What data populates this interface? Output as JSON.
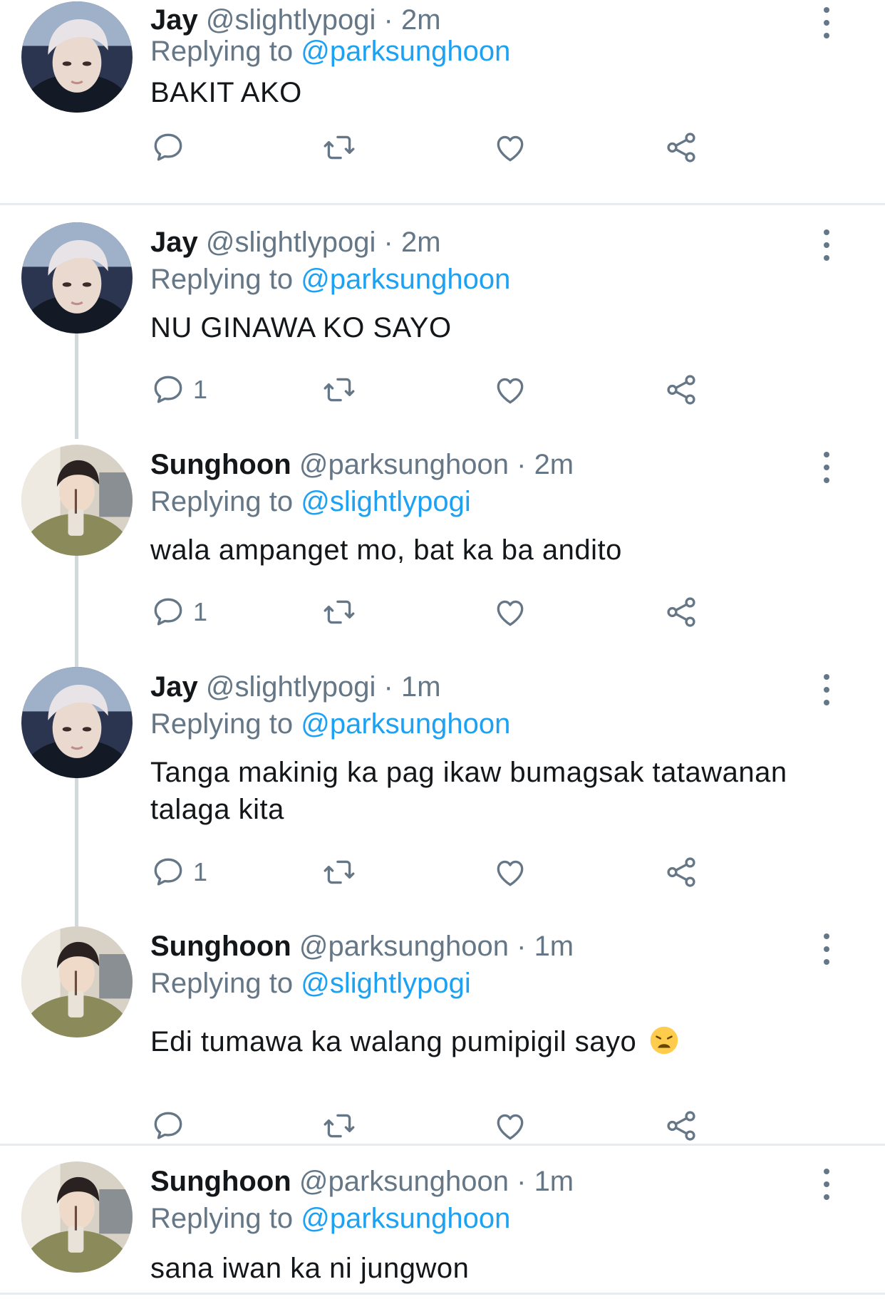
{
  "colors": {
    "accent": "#1da1f2",
    "secondary_text": "#657786",
    "primary_text": "#14171a",
    "thread_line": "#cfd9de",
    "divider": "#e6ecf0"
  },
  "icons": [
    "reply-icon",
    "retweet-icon",
    "like-icon",
    "share-icon",
    "more-options-icon"
  ],
  "tweets": [
    {
      "name": "Jay",
      "handle": "@slightlypogi",
      "sep": "·",
      "time": "2m",
      "replying_prefix": "Replying to",
      "replying_to": "@parksunghoon",
      "text": "BAKIT AKO",
      "reply_count": "",
      "avatar": "jay-avatar"
    },
    {
      "name": "Jay",
      "handle": "@slightlypogi",
      "sep": "·",
      "time": "2m",
      "replying_prefix": "Replying to",
      "replying_to": "@parksunghoon",
      "text": "NU GINAWA KO SAYO",
      "reply_count": "1",
      "avatar": "jay-avatar"
    },
    {
      "name": "Sunghoon",
      "handle": "@parksunghoon",
      "sep": "·",
      "time": "2m",
      "replying_prefix": "Replying to",
      "replying_to": "@slightlypogi",
      "text": "wala ampanget mo, bat ka ba andito",
      "reply_count": "1",
      "avatar": "sunghoon-avatar"
    },
    {
      "name": "Jay",
      "handle": "@slightlypogi",
      "sep": "·",
      "time": "1m",
      "replying_prefix": "Replying to",
      "replying_to": "@parksunghoon",
      "text_line1": "Tanga makinig ka pag ikaw bumagsak tatawanan",
      "text_line2": "talaga kita",
      "reply_count": "1",
      "avatar": "jay-avatar"
    },
    {
      "name": "Sunghoon",
      "handle": "@parksunghoon",
      "sep": "·",
      "time": "1m",
      "replying_prefix": "Replying to",
      "replying_to": "@slightlypogi",
      "text": "Edi tumawa ka walang pumipigil sayo",
      "emoji": "weary-face-emoji",
      "reply_count": "",
      "avatar": "sunghoon-avatar"
    },
    {
      "name": "Sunghoon",
      "handle": "@parksunghoon",
      "sep": "·",
      "time": "1m",
      "replying_prefix": "Replying to",
      "replying_to": "@parksunghoon",
      "text": "sana iwan ka ni jungwon",
      "avatar": "sunghoon-avatar"
    }
  ]
}
